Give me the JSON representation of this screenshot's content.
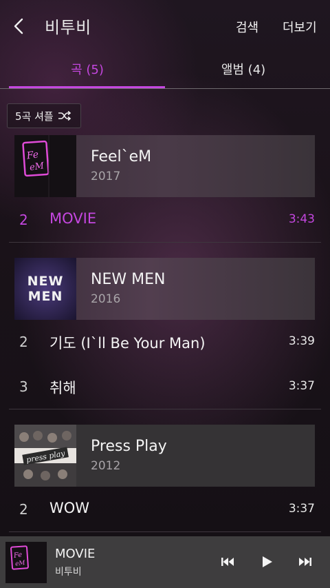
{
  "header": {
    "title": "비투비",
    "search_label": "검색",
    "more_label": "더보기"
  },
  "tabs": [
    {
      "label": "곡 (5)",
      "active": true
    },
    {
      "label": "앨범 (4)",
      "active": false
    }
  ],
  "shuffle": {
    "label": "5곡 셔플"
  },
  "albums": [
    {
      "title": "Feel`eM",
      "year": "2017",
      "art_text": "Feel eM",
      "tracks": [
        {
          "num": "2",
          "title": "MOVIE",
          "duration": "3:43",
          "playing": true
        }
      ]
    },
    {
      "title": "NEW MEN",
      "year": "2016",
      "art_text_top": "NEW",
      "art_text_bottom": "MEN",
      "tracks": [
        {
          "num": "2",
          "title": "기도 (I`ll Be Your Man)",
          "duration": "3:39",
          "playing": false
        },
        {
          "num": "3",
          "title": "취해",
          "duration": "3:37",
          "playing": false
        }
      ]
    },
    {
      "title": "Press Play",
      "year": "2012",
      "art_text": "press play",
      "tracks": [
        {
          "num": "2",
          "title": "WOW",
          "duration": "3:37",
          "playing": false
        }
      ]
    }
  ],
  "mini_player": {
    "title": "MOVIE",
    "artist": "비투비"
  },
  "colors": {
    "accent": "#c547e0",
    "mini_player_bg": "#3e3d3e"
  }
}
